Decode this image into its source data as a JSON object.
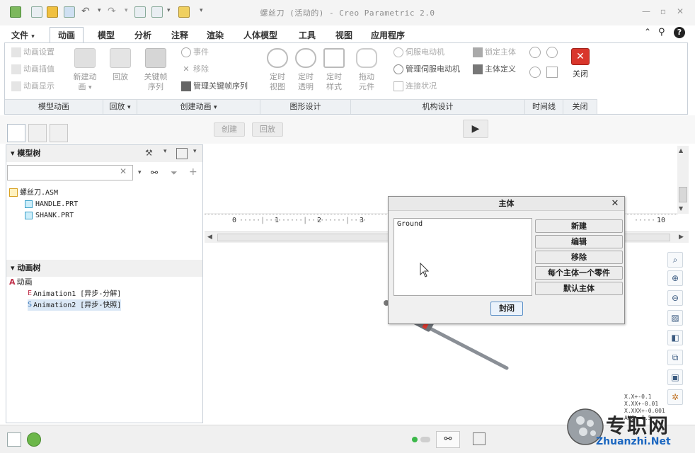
{
  "window": {
    "title": "螺丝刀 (活动的) - Creo Parametric 2.0"
  },
  "menu_tabs": [
    {
      "label": "文件",
      "arrow": "▾",
      "active": false
    },
    {
      "label": "动画",
      "active": true
    },
    {
      "label": "模型",
      "active": false
    },
    {
      "label": "分析",
      "active": false
    },
    {
      "label": "注释",
      "active": false
    },
    {
      "label": "渲染",
      "active": false
    },
    {
      "label": "人体模型",
      "active": false
    },
    {
      "label": "工具",
      "active": false
    },
    {
      "label": "视图",
      "active": false
    },
    {
      "label": "应用程序",
      "active": false
    }
  ],
  "ribbon": {
    "model_animation": {
      "items": [
        "动画设置",
        "动画插值",
        "动画显示"
      ],
      "new_animation": "新建动\n画",
      "footer": "模型动画"
    },
    "playback": {
      "button": "回放",
      "footer": "回放"
    },
    "create_animation": {
      "keyframe_sequence": "关键帧\n序列",
      "event": "事件",
      "remove": "移除",
      "manage_keyframes": "管理关键帧序列",
      "footer": "创建动画"
    },
    "graphic_design": {
      "timed_view": "定时\n视图",
      "timed_transparency": "定时\n透明",
      "timed_style": "定时\n样式",
      "footer": "图形设计"
    },
    "mechanism_design": {
      "drag_components": "拖动\n元件",
      "servo_motor": "伺服电动机",
      "manage_servo": "管理伺服电动机",
      "connection_status": "连接状况",
      "lock_body": "锁定主体",
      "body_definition": "主体定义",
      "footer": "机构设计"
    },
    "timeline": {
      "footer": "时间线"
    },
    "close": {
      "button": "关闭",
      "footer": "关闭"
    },
    "dropdown_arrow": "▾"
  },
  "sub_toolbar": {
    "create": "创建",
    "playback": "回放"
  },
  "model_tree": {
    "header": "模型树",
    "items": [
      {
        "label": "螺丝刀.ASM"
      },
      {
        "label": "HANDLE.PRT"
      },
      {
        "label": "SHANK.PRT"
      }
    ]
  },
  "animation_tree": {
    "header": "动画树",
    "root": "动画",
    "items": [
      {
        "label": "Animation1 [异步-分解]"
      },
      {
        "label": "Animation2 [异步-快照]"
      }
    ]
  },
  "timeline_ruler": [
    "0",
    "1",
    "2",
    "3",
    "10"
  ],
  "dialog": {
    "title": "主体",
    "list_items": [
      "Ground"
    ],
    "buttons": [
      "新建",
      "编辑",
      "移除",
      "每个主体一个零件",
      "默认主体"
    ],
    "close_button": "封闭"
  },
  "tolerance": [
    "X.X+-0.1",
    "X.XX+-0.01",
    "X.XXX+-0.001",
    "ANG+-0.5"
  ],
  "watermark": {
    "text": "专职网",
    "url": "Zhuanzhi.Net"
  },
  "colors": {
    "accent_blue": "#2f6fb3",
    "close_red": "#d9362c",
    "ribbon_footer": "#eef1f4"
  }
}
